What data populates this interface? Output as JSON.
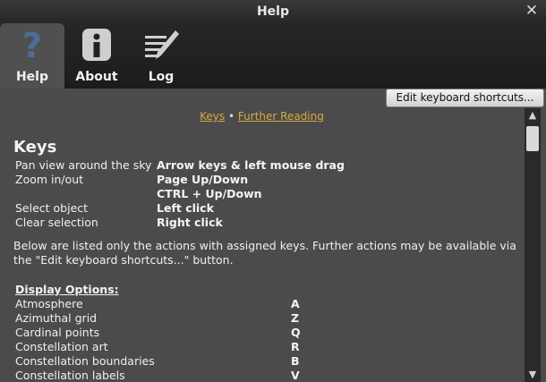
{
  "window": {
    "title": "Help",
    "close_glyph": "✕"
  },
  "tabs": [
    {
      "label": "Help",
      "icon": "question-icon"
    },
    {
      "label": "About",
      "icon": "info-icon"
    },
    {
      "label": "Log",
      "icon": "log-pencil-icon"
    }
  ],
  "edit_button_label": "Edit keyboard shortcuts...",
  "links": {
    "keys": "Keys",
    "separator": "•",
    "further_reading": "Further Reading"
  },
  "keys_title": "Keys",
  "key_rows": [
    {
      "action": "Pan view around the sky",
      "keys": "Arrow keys & left mouse drag"
    },
    {
      "action": "Zoom in/out",
      "keys": "Page Up/Down"
    },
    {
      "action": "",
      "keys": "CTRL + Up/Down"
    },
    {
      "action": "Select object",
      "keys": "Left click"
    },
    {
      "action": "Clear selection",
      "keys": "Right click"
    }
  ],
  "note": "Below are listed only the actions with assigned keys. Further actions may be available via the \"Edit keyboard shortcuts...\" button.",
  "section_title": "Display Options:",
  "display_options": [
    {
      "action": "Atmosphere",
      "key": "A"
    },
    {
      "action": "Azimuthal grid",
      "key": "Z"
    },
    {
      "action": "Cardinal points",
      "key": "Q"
    },
    {
      "action": "Constellation art",
      "key": "R"
    },
    {
      "action": "Constellation boundaries",
      "key": "B"
    },
    {
      "action": "Constellation labels",
      "key": "V"
    }
  ],
  "scrollbar": {
    "up_glyph": "▲",
    "down_glyph": "▼"
  },
  "colors": {
    "link": "#d7a842",
    "content_bg": "#4b4b4b",
    "active_tab": "#505050",
    "icon_blue": "#4f6d98",
    "icon_grey": "#cfcfcf"
  }
}
